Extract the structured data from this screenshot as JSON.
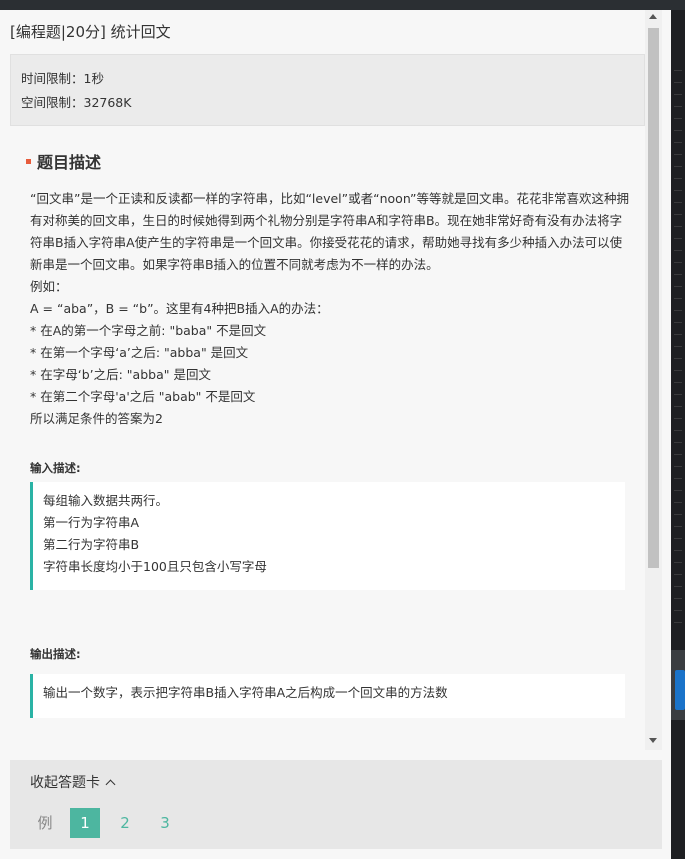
{
  "title": "[编程题|20分] 统计回文",
  "limits": {
    "time": "时间限制：1秒",
    "space": "空间限制：32768K"
  },
  "section_title": "题目描述",
  "description": [
    "“回文串”是一个正读和反读都一样的字符串，比如“level”或者“noon”等等就是回文串。花花非常喜欢这种拥有对称美的回文串，生日的时候她得到两个礼物分别是字符串A和字符串B。现在她非常好奇有没有办法将字符串B插入字符串A使产生的字符串是一个回文串。你接受花花的请求，帮助她寻找有多少种插入办法可以使新串是一个回文串。如果字符串B插入的位置不同就考虑为不一样的办法。",
    "例如：",
    "A = “aba”，B = “b”。这里有4种把B插入A的办法：",
    "* 在A的第一个字母之前: \"baba\" 不是回文",
    "* 在第一个字母‘a’之后: \"abba\" 是回文",
    "* 在字母‘b’之后: \"abba\" 是回文",
    "* 在第二个字母'a'之后 \"abab\" 不是回文",
    "所以满足条件的答案为2"
  ],
  "input": {
    "label": "输入描述:",
    "lines": [
      "每组输入数据共两行。",
      "第一行为字符串A",
      "第二行为字符串B",
      "字符串长度均小于100且只包含小写字母"
    ]
  },
  "output": {
    "label": "输出描述:",
    "lines": [
      "输出一个数字，表示把字符串B插入字符串A之后构成一个回文串的方法数"
    ]
  },
  "footer": {
    "collapse_label": "收起答题卡",
    "pager": [
      "例",
      "1",
      "2",
      "3"
    ]
  },
  "colors": {
    "accent": "#4db6a0",
    "border_accent": "#2ab3a5",
    "section_mark": "#e75c3c"
  }
}
